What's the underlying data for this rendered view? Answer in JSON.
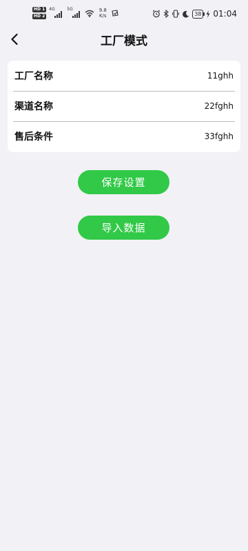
{
  "status_bar": {
    "sim1": "HD 1",
    "sim2": "HD 2",
    "net1": "4G",
    "net2": "5G",
    "speed_value": "9.8",
    "speed_unit": "K/s",
    "battery": "38",
    "time": "01:04"
  },
  "header": {
    "title": "工厂模式"
  },
  "info": {
    "rows": [
      {
        "label": "工厂名称",
        "value": "11ghh"
      },
      {
        "label": "渠道名称",
        "value": "22fghh"
      },
      {
        "label": "售后条件",
        "value": "33fghh"
      }
    ]
  },
  "buttons": {
    "save": "保存设置",
    "import": "导入数据"
  },
  "colors": {
    "accent": "#31c947",
    "background": "#f1f1f6",
    "card": "#ffffff"
  }
}
